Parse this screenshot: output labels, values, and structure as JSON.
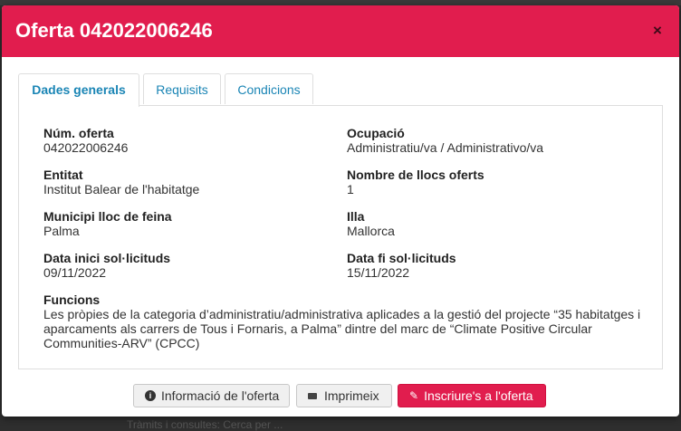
{
  "modal": {
    "title": "Oferta 042022006246",
    "close_label": "×"
  },
  "tabs": [
    {
      "label": "Dades generals",
      "active": true
    },
    {
      "label": "Requisits",
      "active": false
    },
    {
      "label": "Condicions",
      "active": false
    }
  ],
  "fields": {
    "num_oferta": {
      "label": "Núm. oferta",
      "value": "042022006246"
    },
    "ocupacio": {
      "label": "Ocupació",
      "value": "Administratiu/va / Administrativo/va"
    },
    "entitat": {
      "label": "Entitat",
      "value": "Institut Balear de l'habitatge"
    },
    "nombre_llocs": {
      "label": "Nombre de llocs oferts",
      "value": "1"
    },
    "municipi": {
      "label": "Municipi lloc de feina",
      "value": "Palma"
    },
    "illa": {
      "label": "Illa",
      "value": "Mallorca"
    },
    "data_inici": {
      "label": "Data inici sol·licituds",
      "value": "09/11/2022"
    },
    "data_fi": {
      "label": "Data fi sol·licituds",
      "value": "15/11/2022"
    },
    "funcions": {
      "label": "Funcions",
      "value": "Les pròpies de la categoria d’administratiu/administrativa aplicades a la gestió del projecte “35 habitatges i aparcaments als carrers de Tous i Fornaris, a Palma” dintre del marc de “Climate Positive Circular Communities-ARV” (CPCC)"
    }
  },
  "footer": {
    "info_button": "Informació de l'oferta",
    "print_button": "Imprimeix",
    "apply_button": "Inscriure's a l'oferta"
  },
  "background_text": "Tràmits i consultes: Cerca per ...",
  "colors": {
    "accent": "#e11d4e",
    "tab_link": "#1a85b5"
  },
  "icons": {
    "info": "info-circle-icon",
    "print": "print-icon",
    "apply": "pencil-icon",
    "close": "close-icon"
  }
}
